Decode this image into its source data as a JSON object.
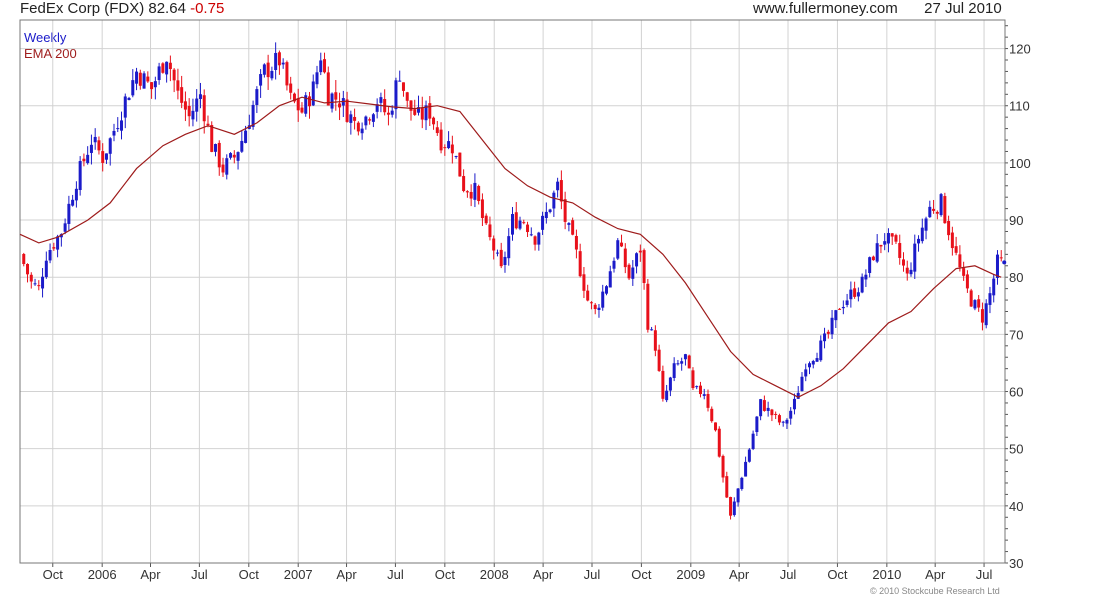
{
  "header": {
    "ticker_label": "FedEx Corp (FDX)",
    "last": "82.64",
    "change": "-0.75",
    "site": "www.fullermoney.com",
    "date": "27 Jul 2010"
  },
  "footer": {
    "copyright": "© 2010 Stockcube Research Ltd"
  },
  "colors": {
    "up": "#1b1bc9",
    "down": "#e8101a",
    "ema": "#9e1b1b",
    "grid": "#d2d2d2"
  },
  "chart_data": {
    "type": "candlestick",
    "title": "FedEx Corp (FDX) 82.64 -0.75",
    "period_label": "Weekly",
    "grid": true,
    "y_axis_side": "right",
    "ylim": [
      30,
      125
    ],
    "y_ticks": [
      30,
      40,
      50,
      60,
      70,
      80,
      90,
      100,
      110,
      120
    ],
    "x_range": [
      "2005-08-01",
      "2010-08-09"
    ],
    "x_ticks": [
      {
        "date": "2005-10-01",
        "label": "Oct"
      },
      {
        "date": "2006-01-01",
        "label": "2006"
      },
      {
        "date": "2006-04-01",
        "label": "Apr"
      },
      {
        "date": "2006-07-01",
        "label": "Jul"
      },
      {
        "date": "2006-10-01",
        "label": "Oct"
      },
      {
        "date": "2007-01-01",
        "label": "2007"
      },
      {
        "date": "2007-04-01",
        "label": "Apr"
      },
      {
        "date": "2007-07-01",
        "label": "Jul"
      },
      {
        "date": "2007-10-01",
        "label": "Oct"
      },
      {
        "date": "2008-01-01",
        "label": "2008"
      },
      {
        "date": "2008-04-01",
        "label": "Apr"
      },
      {
        "date": "2008-07-01",
        "label": "Jul"
      },
      {
        "date": "2008-10-01",
        "label": "Oct"
      },
      {
        "date": "2009-01-01",
        "label": "2009"
      },
      {
        "date": "2009-04-01",
        "label": "Apr"
      },
      {
        "date": "2009-07-01",
        "label": "Jul"
      },
      {
        "date": "2009-10-01",
        "label": "Oct"
      },
      {
        "date": "2010-01-01",
        "label": "2010"
      },
      {
        "date": "2010-04-01",
        "label": "Apr"
      },
      {
        "date": "2010-07-01",
        "label": "Jul"
      }
    ],
    "price_anchors": [
      [
        "2005-08-08",
        84
      ],
      [
        "2005-08-29",
        79
      ],
      [
        "2005-09-12",
        78
      ],
      [
        "2005-09-26",
        84
      ],
      [
        "2005-10-24",
        88
      ],
      [
        "2005-11-21",
        97
      ],
      [
        "2005-12-19",
        104
      ],
      [
        "2006-01-09",
        101
      ],
      [
        "2006-01-23",
        104
      ],
      [
        "2006-02-20",
        111
      ],
      [
        "2006-03-13",
        116
      ],
      [
        "2006-04-10",
        113
      ],
      [
        "2006-05-08",
        119
      ],
      [
        "2006-05-29",
        112
      ],
      [
        "2006-06-19",
        108
      ],
      [
        "2006-07-10",
        112
      ],
      [
        "2006-07-31",
        103
      ],
      [
        "2006-08-21",
        99
      ],
      [
        "2006-09-11",
        101
      ],
      [
        "2006-09-25",
        104
      ],
      [
        "2006-10-16",
        110
      ],
      [
        "2006-11-06",
        116
      ],
      [
        "2006-12-04",
        118
      ],
      [
        "2006-12-25",
        111
      ],
      [
        "2007-01-15",
        109
      ],
      [
        "2007-02-05",
        113
      ],
      [
        "2007-02-19",
        119
      ],
      [
        "2007-03-05",
        112
      ],
      [
        "2007-03-26",
        111
      ],
      [
        "2007-04-23",
        107
      ],
      [
        "2007-05-14",
        108
      ],
      [
        "2007-06-04",
        111
      ],
      [
        "2007-06-25",
        108
      ],
      [
        "2007-07-16",
        116
      ],
      [
        "2007-07-30",
        110
      ],
      [
        "2007-08-20",
        108
      ],
      [
        "2007-09-10",
        109
      ],
      [
        "2007-10-01",
        104
      ],
      [
        "2007-10-22",
        103
      ],
      [
        "2007-11-12",
        96
      ],
      [
        "2007-12-03",
        95
      ],
      [
        "2007-12-24",
        88
      ],
      [
        "2008-01-07",
        85
      ],
      [
        "2008-01-21",
        81
      ],
      [
        "2008-02-11",
        90
      ],
      [
        "2008-03-03",
        90
      ],
      [
        "2008-03-24",
        87
      ],
      [
        "2008-04-14",
        91
      ],
      [
        "2008-05-05",
        96
      ],
      [
        "2008-05-19",
        90
      ],
      [
        "2008-06-09",
        84
      ],
      [
        "2008-06-30",
        76
      ],
      [
        "2008-07-14",
        74
      ],
      [
        "2008-08-04",
        79
      ],
      [
        "2008-08-25",
        86
      ],
      [
        "2008-09-15",
        80
      ],
      [
        "2008-10-06",
        85
      ],
      [
        "2008-10-20",
        72
      ],
      [
        "2008-11-03",
        68
      ],
      [
        "2008-11-17",
        58
      ],
      [
        "2008-12-08",
        64
      ],
      [
        "2008-12-29",
        66
      ],
      [
        "2009-01-12",
        60
      ],
      [
        "2009-02-02",
        60
      ],
      [
        "2009-02-23",
        53
      ],
      [
        "2009-03-09",
        45
      ],
      [
        "2009-03-23",
        38
      ],
      [
        "2009-04-06",
        43
      ],
      [
        "2009-04-27",
        50
      ],
      [
        "2009-05-18",
        58
      ],
      [
        "2009-06-08",
        56
      ],
      [
        "2009-06-29",
        54
      ],
      [
        "2009-07-20",
        58
      ],
      [
        "2009-08-10",
        65
      ],
      [
        "2009-08-31",
        67
      ],
      [
        "2009-09-21",
        70
      ],
      [
        "2009-10-12",
        75
      ],
      [
        "2009-11-02",
        77
      ],
      [
        "2009-11-23",
        79
      ],
      [
        "2009-12-14",
        84
      ],
      [
        "2010-01-04",
        87
      ],
      [
        "2010-01-25",
        85
      ],
      [
        "2010-02-15",
        80
      ],
      [
        "2010-03-08",
        87
      ],
      [
        "2010-03-29",
        92
      ],
      [
        "2010-04-19",
        93
      ],
      [
        "2010-05-10",
        86
      ],
      [
        "2010-05-31",
        79
      ],
      [
        "2010-06-14",
        76
      ],
      [
        "2010-07-05",
        73
      ],
      [
        "2010-07-19",
        77
      ],
      [
        "2010-08-02",
        82.6
      ]
    ],
    "ema_200": [
      [
        "2005-08-01",
        87.5
      ],
      [
        "2005-09-05",
        86
      ],
      [
        "2005-10-10",
        87
      ],
      [
        "2005-12-05",
        90
      ],
      [
        "2006-01-16",
        93
      ],
      [
        "2006-03-06",
        99
      ],
      [
        "2006-04-24",
        103
      ],
      [
        "2006-06-05",
        105
      ],
      [
        "2006-07-17",
        106.5
      ],
      [
        "2006-09-04",
        105
      ],
      [
        "2006-10-16",
        107
      ],
      [
        "2006-11-27",
        110
      ],
      [
        "2007-01-08",
        111.5
      ],
      [
        "2007-02-19",
        110.5
      ],
      [
        "2007-04-02",
        110.8
      ],
      [
        "2007-05-14",
        110.3
      ],
      [
        "2007-06-25",
        109.8
      ],
      [
        "2007-08-06",
        109.5
      ],
      [
        "2007-09-17",
        110
      ],
      [
        "2007-10-29",
        109
      ],
      [
        "2007-12-10",
        104
      ],
      [
        "2008-01-21",
        99
      ],
      [
        "2008-03-03",
        96
      ],
      [
        "2008-04-14",
        94
      ],
      [
        "2008-05-26",
        93
      ],
      [
        "2008-07-07",
        90.5
      ],
      [
        "2008-08-18",
        88.5
      ],
      [
        "2008-09-29",
        87.5
      ],
      [
        "2008-11-10",
        84
      ],
      [
        "2008-12-22",
        79
      ],
      [
        "2009-02-02",
        73
      ],
      [
        "2009-03-16",
        67
      ],
      [
        "2009-04-27",
        63
      ],
      [
        "2009-06-08",
        61
      ],
      [
        "2009-07-20",
        59
      ],
      [
        "2009-08-31",
        61
      ],
      [
        "2009-10-12",
        64
      ],
      [
        "2009-11-23",
        68
      ],
      [
        "2010-01-04",
        72
      ],
      [
        "2010-02-15",
        74
      ],
      [
        "2010-03-29",
        78
      ],
      [
        "2010-05-10",
        81.5
      ],
      [
        "2010-06-14",
        82
      ],
      [
        "2010-07-19",
        80.5
      ],
      [
        "2010-08-02",
        80
      ]
    ]
  }
}
